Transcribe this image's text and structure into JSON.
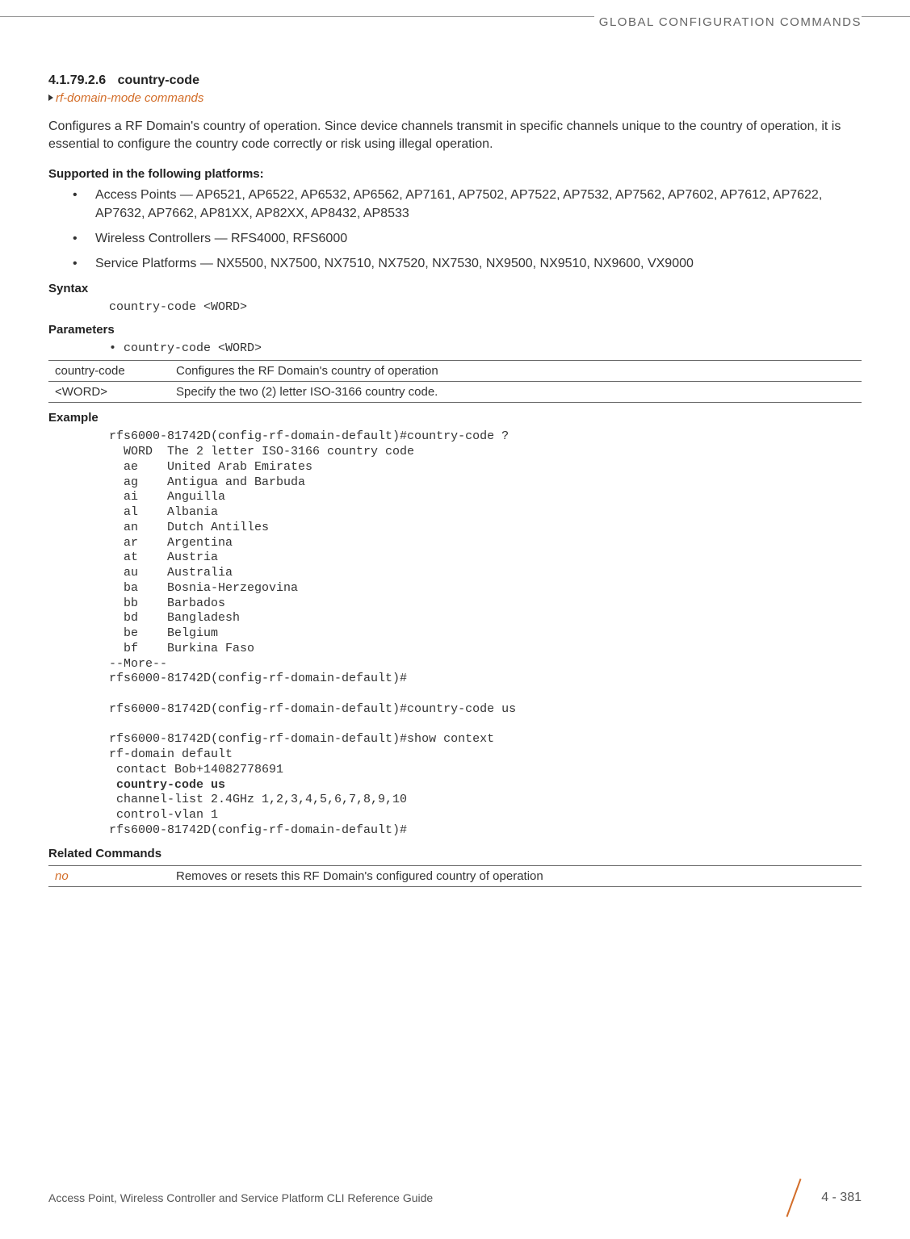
{
  "header": {
    "chapter_title": "GLOBAL CONFIGURATION COMMANDS"
  },
  "section": {
    "number": "4.1.79.2.6",
    "title": "country-code",
    "breadcrumb": "rf-domain-mode commands"
  },
  "description": "Configures a RF Domain's country of operation. Since device channels transmit in specific channels unique to the country of operation, it is essential to configure the country code correctly or risk using illegal operation.",
  "supported": {
    "heading": "Supported in the following platforms:",
    "items": [
      "Access Points — AP6521, AP6522, AP6532, AP6562, AP7161, AP7502, AP7522, AP7532, AP7562, AP7602, AP7612, AP7622, AP7632, AP7662, AP81XX, AP82XX, AP8432, AP8533",
      "Wireless Controllers — RFS4000, RFS6000",
      "Service Platforms — NX5500, NX7500, NX7510, NX7520, NX7530, NX9500, NX9510, NX9600, VX9000"
    ]
  },
  "syntax": {
    "heading": "Syntax",
    "code": "country-code <WORD>"
  },
  "parameters": {
    "heading": "Parameters",
    "bullet": "• country-code <WORD>",
    "rows": [
      {
        "name": "country-code",
        "desc": "Configures the RF Domain's country of operation"
      },
      {
        "name": "<WORD>",
        "desc": "Specify the two (2) letter ISO-3166 country code."
      }
    ]
  },
  "example": {
    "heading": "Example",
    "pre1": "rfs6000-81742D(config-rf-domain-default)#country-code ?\n  WORD  The 2 letter ISO-3166 country code\n  ae    United Arab Emirates\n  ag    Antigua and Barbuda\n  ai    Anguilla\n  al    Albania\n  an    Dutch Antilles\n  ar    Argentina\n  at    Austria\n  au    Australia\n  ba    Bosnia-Herzegovina\n  bb    Barbados\n  bd    Bangladesh\n  be    Belgium\n  bf    Burkina Faso\n--More--\nrfs6000-81742D(config-rf-domain-default)#\n\nrfs6000-81742D(config-rf-domain-default)#country-code us\n\nrfs6000-81742D(config-rf-domain-default)#show context\nrf-domain default\n contact Bob+14082778691",
    "bold": " country-code us",
    "pre2": " channel-list 2.4GHz 1,2,3,4,5,6,7,8,9,10\n control-vlan 1\nrfs6000-81742D(config-rf-domain-default)#"
  },
  "related": {
    "heading": "Related Commands",
    "rows": [
      {
        "name": "no",
        "desc": "Removes or resets this RF Domain's configured country of operation"
      }
    ]
  },
  "footer": {
    "doc_title": "Access Point, Wireless Controller and Service Platform CLI Reference Guide",
    "page": "4 - 381"
  }
}
